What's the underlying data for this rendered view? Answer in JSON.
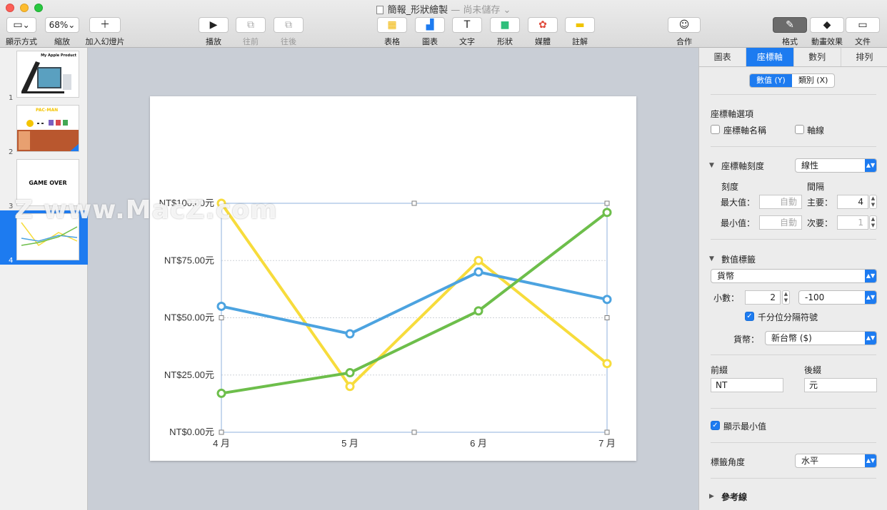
{
  "window": {
    "title": "簡報_形狀繪製",
    "status": "— 尚未儲存",
    "status_arrow": "⌄"
  },
  "toolbar": {
    "view_label": "顯示方式",
    "zoom_value": "68%",
    "zoom_label": "縮放",
    "add_slide_label": "加入幻燈片",
    "play_label": "播放",
    "forward_label": "往前",
    "backward_label": "往後",
    "table_label": "表格",
    "chart_label": "圖表",
    "text_label": "文字",
    "shape_label": "形狀",
    "media_label": "媒體",
    "comment_label": "註解",
    "collaborate_label": "合作",
    "format_label": "格式",
    "animate_label": "動畫效果",
    "document_label": "文件"
  },
  "navigator": {
    "slides": [
      {
        "num": "1",
        "text": "My Apple Product"
      },
      {
        "num": "2",
        "text": "PAC-MAN"
      },
      {
        "num": "3",
        "text": "GAME OVER"
      },
      {
        "num": "4",
        "text": ""
      }
    ]
  },
  "watermark": "Z www.MacZ.com",
  "chart_data": {
    "type": "line",
    "categories": [
      "4 月",
      "5 月",
      "6 月",
      "7 月"
    ],
    "ylim": [
      0,
      100
    ],
    "yticks": [
      0,
      25,
      50,
      75,
      100
    ],
    "ytick_labels": [
      "NT$0.00元",
      "NT$25.00元",
      "NT$50.00元",
      "NT$75.00元",
      "NT$100.00元"
    ],
    "grid": true,
    "series": [
      {
        "color": "#f7dc3c",
        "values": [
          100,
          20,
          75,
          30
        ]
      },
      {
        "color": "#4ca3e0",
        "values": [
          55,
          43,
          70,
          58
        ]
      },
      {
        "color": "#6dbe4b",
        "values": [
          17,
          26,
          53,
          96
        ]
      }
    ]
  },
  "inspector": {
    "tabs": [
      "圖表",
      "座標軸",
      "數列",
      "排列"
    ],
    "active_tab": "座標軸",
    "seg_value": "數值 (Y)",
    "seg_category": "類別 (X)",
    "axis_options_title": "座標軸選項",
    "axis_name_label": "座標軸名稱",
    "axis_line_label": "軸線",
    "axis_scale_title": "座標軸刻度",
    "axis_scale_value": "線性",
    "scale_label": "刻度",
    "interval_label": "間隔",
    "max_label": "最大值：",
    "max_placeholder": "自動",
    "major_label": "主要：",
    "major_value": "4",
    "min_label": "最小值：",
    "min_placeholder": "自動",
    "minor_label": "次要：",
    "minor_value": "1",
    "value_labels_title": "數值標籤",
    "format_value": "貨幣",
    "decimals_label": "小數：",
    "decimals_value": "2",
    "negative_value": "-100",
    "thousands_label": "千分位分隔符號",
    "currency_label": "貨幣：",
    "currency_value": "新台幣 ($)",
    "prefix_label": "前綴",
    "prefix_value": "NT",
    "suffix_label": "後綴",
    "suffix_value": "元",
    "show_min_label": "顯示最小值",
    "label_angle_label": "標籤角度",
    "label_angle_value": "水平",
    "reference_lines_label": "參考線"
  }
}
